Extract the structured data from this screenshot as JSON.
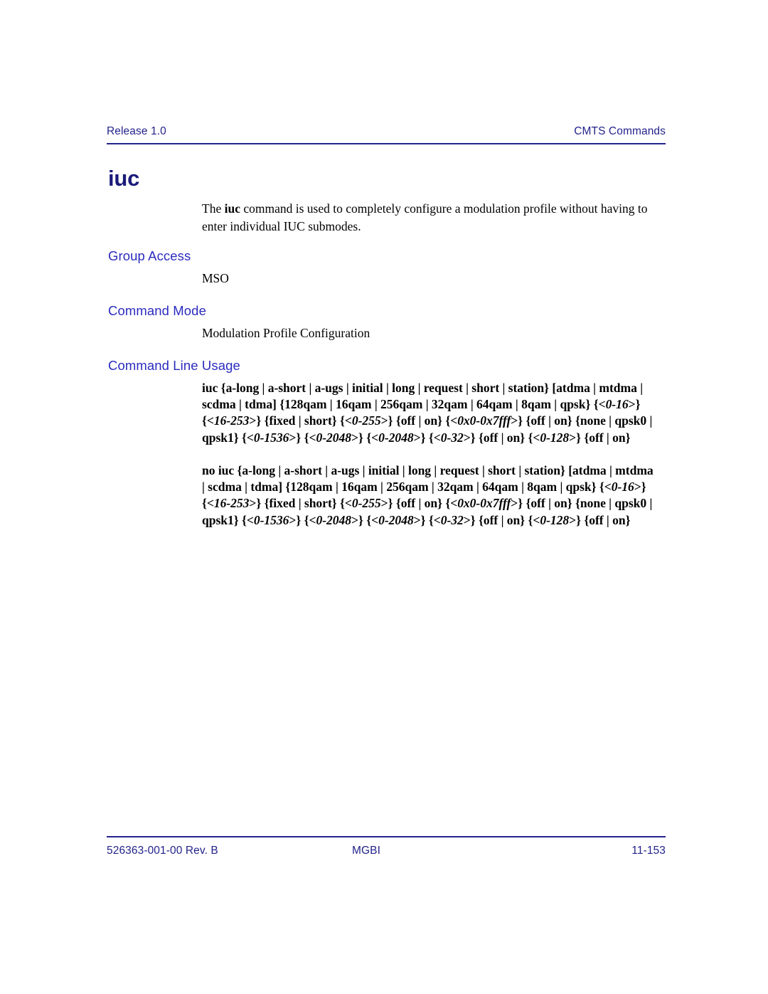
{
  "header": {
    "left": "Release 1.0",
    "right": "CMTS Commands"
  },
  "command": {
    "title": "iuc",
    "description_pre": "The ",
    "description_bold": "iuc",
    "description_post": " command is used to completely configure a modulation profile without having to enter individual IUC submodes."
  },
  "sections": {
    "group_access": {
      "heading": "Group Access",
      "value": "MSO"
    },
    "command_mode": {
      "heading": "Command Mode",
      "value": "Modulation Profile Configuration"
    },
    "command_line_usage": {
      "heading": "Command Line Usage"
    }
  },
  "usage": {
    "form1": {
      "segments": [
        {
          "text": "iuc {a-long | a-short | a-ugs | initial | long | request | short | station} [atdma | mtdma | scdma | tdma] {128qam | 16qam | 256qam | 32qam | 64qam | 8qam | qpsk} {<",
          "italic": false
        },
        {
          "text": "0-16",
          "italic": true
        },
        {
          "text": ">} {<",
          "italic": false
        },
        {
          "text": "16-253",
          "italic": true
        },
        {
          "text": ">} {fixed | short} {<",
          "italic": false
        },
        {
          "text": "0-255",
          "italic": true
        },
        {
          "text": ">} {off | on} {<",
          "italic": false
        },
        {
          "text": "0x0-0x7fff",
          "italic": true
        },
        {
          "text": ">} {off | on} {none | qpsk0 | qpsk1} {<",
          "italic": false
        },
        {
          "text": "0-1536",
          "italic": true
        },
        {
          "text": ">} {<",
          "italic": false
        },
        {
          "text": "0-2048",
          "italic": true
        },
        {
          "text": ">} {<",
          "italic": false
        },
        {
          "text": "0-2048",
          "italic": true
        },
        {
          "text": ">} {<",
          "italic": false
        },
        {
          "text": "0-32",
          "italic": true
        },
        {
          "text": ">} {off | on} {<",
          "italic": false
        },
        {
          "text": "0-128",
          "italic": true
        },
        {
          "text": ">} {off | on}",
          "italic": false
        }
      ]
    },
    "form2": {
      "segments": [
        {
          "text": "no iuc {a-long | a-short | a-ugs | initial | long | request | short | station} [atdma | mtdma | scdma | tdma] {128qam | 16qam | 256qam | 32qam | 64qam | 8qam | qpsk} {<",
          "italic": false
        },
        {
          "text": "0-16",
          "italic": true
        },
        {
          "text": ">} {<",
          "italic": false
        },
        {
          "text": "16-253",
          "italic": true
        },
        {
          "text": ">} {fixed | short} {<",
          "italic": false
        },
        {
          "text": "0-255",
          "italic": true
        },
        {
          "text": ">} {off | on} {<",
          "italic": false
        },
        {
          "text": "0x0-0x7fff",
          "italic": true
        },
        {
          "text": ">} {off | on} {none | qpsk0 | qpsk1} {<",
          "italic": false
        },
        {
          "text": "0-1536",
          "italic": true
        },
        {
          "text": ">} {<",
          "italic": false
        },
        {
          "text": "0-2048",
          "italic": true
        },
        {
          "text": ">} {<",
          "italic": false
        },
        {
          "text": "0-2048",
          "italic": true
        },
        {
          "text": ">} {<",
          "italic": false
        },
        {
          "text": "0-32",
          "italic": true
        },
        {
          "text": ">} {off | on} {<",
          "italic": false
        },
        {
          "text": "0-128",
          "italic": true
        },
        {
          "text": ">} {off | on}",
          "italic": false
        }
      ]
    }
  },
  "footer": {
    "left": "526363-001-00 Rev. B",
    "center": "MGBI",
    "right": "11-153"
  },
  "colors": {
    "header_blue": "#23238c",
    "title_blue": "#1b1b7a",
    "section_blue": "#2b2bbf",
    "body_black": "#000000"
  }
}
